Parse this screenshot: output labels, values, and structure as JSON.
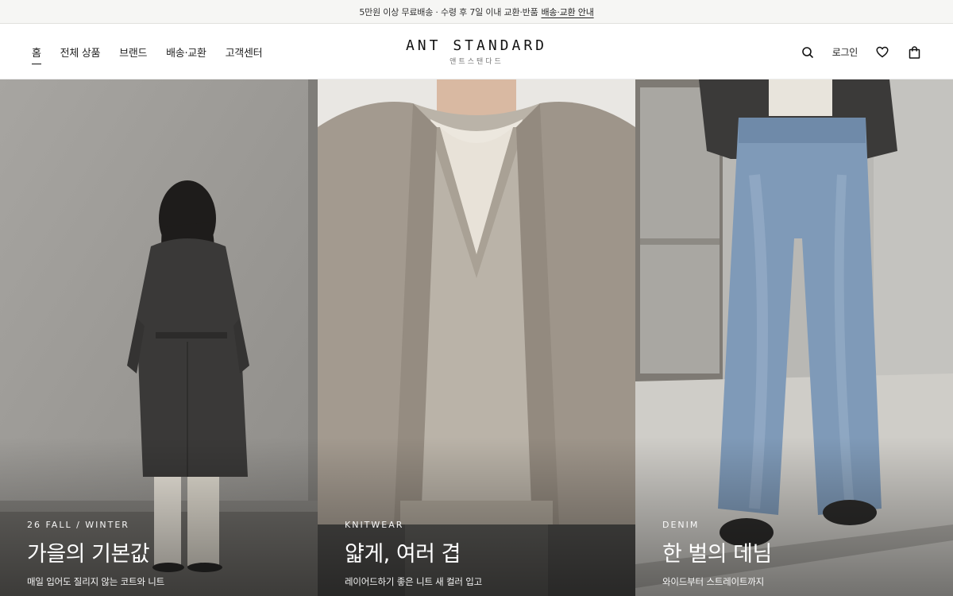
{
  "announcement": {
    "text": "5만원 이상 무료배송 · 수령 후 7일 이내 교환·반품",
    "link_label": "배송·교환 안내"
  },
  "header": {
    "nav": [
      {
        "label": "홈",
        "active": true
      },
      {
        "label": "전체 상품",
        "active": false
      },
      {
        "label": "브랜드",
        "active": false
      },
      {
        "label": "배송·교환",
        "active": false
      },
      {
        "label": "고객센터",
        "active": false
      }
    ],
    "logo": {
      "main": "ANT STANDARD",
      "sub": "앤트스탠다드"
    },
    "utils": {
      "search_icon": "search-icon",
      "login_label": "로그인",
      "wishlist_icon": "heart-icon",
      "cart_icon": "shopping-bag-icon"
    }
  },
  "hero": {
    "panels": [
      {
        "eyebrow": "26 FALL / WINTER",
        "title": "가을의 기본값",
        "desc": "매일 입어도 질리지 않는 코트와 니트"
      },
      {
        "eyebrow": "KNITWEAR",
        "title": "얇게, 여러 겹",
        "desc": "레이어드하기 좋은 니트 새 컬러 입고"
      },
      {
        "eyebrow": "DENIM",
        "title": "한 벌의 데님",
        "desc": "와이드부터 스트레이트까지"
      }
    ]
  },
  "colors": {
    "announce_bg": "#f6f6f4",
    "text": "#1a1a1a",
    "wall_grey": "#9a9894",
    "knit_beige": "#b3aba0",
    "denim_blue": "#7f9ab8"
  }
}
